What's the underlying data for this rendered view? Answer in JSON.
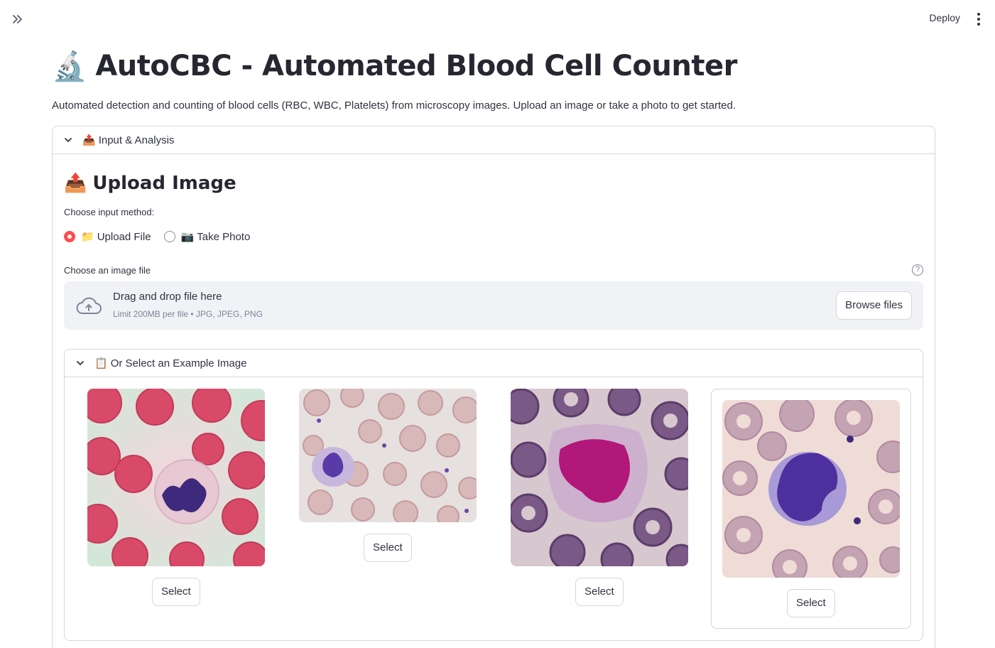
{
  "topbar": {
    "deploy_label": "Deploy"
  },
  "page": {
    "title_emoji": "🔬",
    "title": "AutoCBC - Automated Blood Cell Counter",
    "subtitle": "Automated detection and counting of blood cells (RBC, WBC, Platelets) from microscopy images. Upload an image or take a photo to get started."
  },
  "input_expander": {
    "emoji": "📤",
    "label": "Input & Analysis",
    "heading_emoji": "📤",
    "heading": "Upload Image",
    "input_method_label": "Choose input method:",
    "options": [
      {
        "emoji": "📁",
        "label": "Upload File",
        "checked": true
      },
      {
        "emoji": "📷",
        "label": "Take Photo",
        "checked": false
      }
    ],
    "file_label": "Choose an image file",
    "dropzone_title": "Drag and drop file here",
    "dropzone_limit": "Limit 200MB per file • JPG, JPEG, PNG",
    "browse_label": "Browse files"
  },
  "examples": {
    "emoji": "📋",
    "label": "Or Select an Example Image",
    "items": [
      {
        "alt": "neutrophil example",
        "select_label": "Select"
      },
      {
        "alt": "blood smear example",
        "select_label": "Select"
      },
      {
        "alt": "monocyte example",
        "select_label": "Select"
      },
      {
        "alt": "lymphocyte example",
        "select_label": "Select"
      }
    ]
  },
  "colors": {
    "accent": "#ff4b4b",
    "border": "#d6d6d9",
    "dropzone_bg": "#f0f2f6",
    "text": "#31333f"
  }
}
